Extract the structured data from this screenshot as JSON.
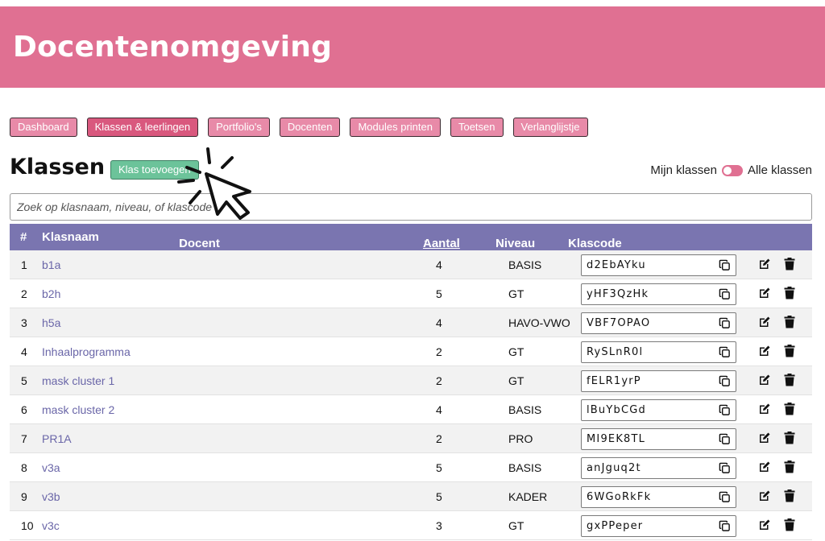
{
  "header": {
    "title": "Docentenomgeving"
  },
  "nav": [
    {
      "label": "Dashboard",
      "active": false
    },
    {
      "label": "Klassen & leerlingen",
      "active": true
    },
    {
      "label": "Portfolio's",
      "active": false
    },
    {
      "label": "Docenten",
      "active": false
    },
    {
      "label": "Modules printen",
      "active": false
    },
    {
      "label": "Toetsen",
      "active": false
    },
    {
      "label": "Verlanglijstje",
      "active": false
    }
  ],
  "section": {
    "title": "Klassen",
    "add_label": "Klas toevoegen",
    "toggle_left": "Mijn klassen",
    "toggle_right": "Alle klassen"
  },
  "search": {
    "placeholder": "Zoek op klasnaam, niveau, of klascode"
  },
  "table": {
    "headers": {
      "num": "#",
      "name": "Klasnaam",
      "docent": "Docent",
      "aantal": "Aantal",
      "niveau": "Niveau",
      "code": "Klascode"
    },
    "rows": [
      {
        "num": "1",
        "name": "b1a",
        "aantal": "4",
        "niveau": "BASIS",
        "code": "d2EbAYku"
      },
      {
        "num": "2",
        "name": "b2h",
        "aantal": "5",
        "niveau": "GT",
        "code": "yHF3QzHk"
      },
      {
        "num": "3",
        "name": "h5a",
        "aantal": "4",
        "niveau": "HAVO-VWO",
        "code": "VBF7OPAO"
      },
      {
        "num": "4",
        "name": "Inhaalprogramma",
        "aantal": "2",
        "niveau": "GT",
        "code": "RySLnR0l"
      },
      {
        "num": "5",
        "name": "mask cluster 1",
        "aantal": "2",
        "niveau": "GT",
        "code": "fELR1yrP"
      },
      {
        "num": "6",
        "name": "mask cluster 2",
        "aantal": "4",
        "niveau": "BASIS",
        "code": "lBuYbCGd"
      },
      {
        "num": "7",
        "name": "PR1A",
        "aantal": "2",
        "niveau": "PRO",
        "code": "MI9EK8TL"
      },
      {
        "num": "8",
        "name": "v3a",
        "aantal": "5",
        "niveau": "BASIS",
        "code": "anJguq2t"
      },
      {
        "num": "9",
        "name": "v3b",
        "aantal": "5",
        "niveau": "KADER",
        "code": "6WGoRkFk"
      },
      {
        "num": "10",
        "name": "v3c",
        "aantal": "3",
        "niveau": "GT",
        "code": "gxPPeper"
      }
    ]
  },
  "colors": {
    "brand": "#e07092",
    "nav": "#e88aa8",
    "nav_active": "#d9587e",
    "add": "#6cc39a",
    "table_header": "#7a75b0",
    "link": "#6a66a8"
  },
  "icons": {
    "copy": "copy-icon",
    "edit": "edit-icon",
    "delete": "trash-icon",
    "sort": "sort-icon",
    "cursor": "cursor-icon"
  }
}
